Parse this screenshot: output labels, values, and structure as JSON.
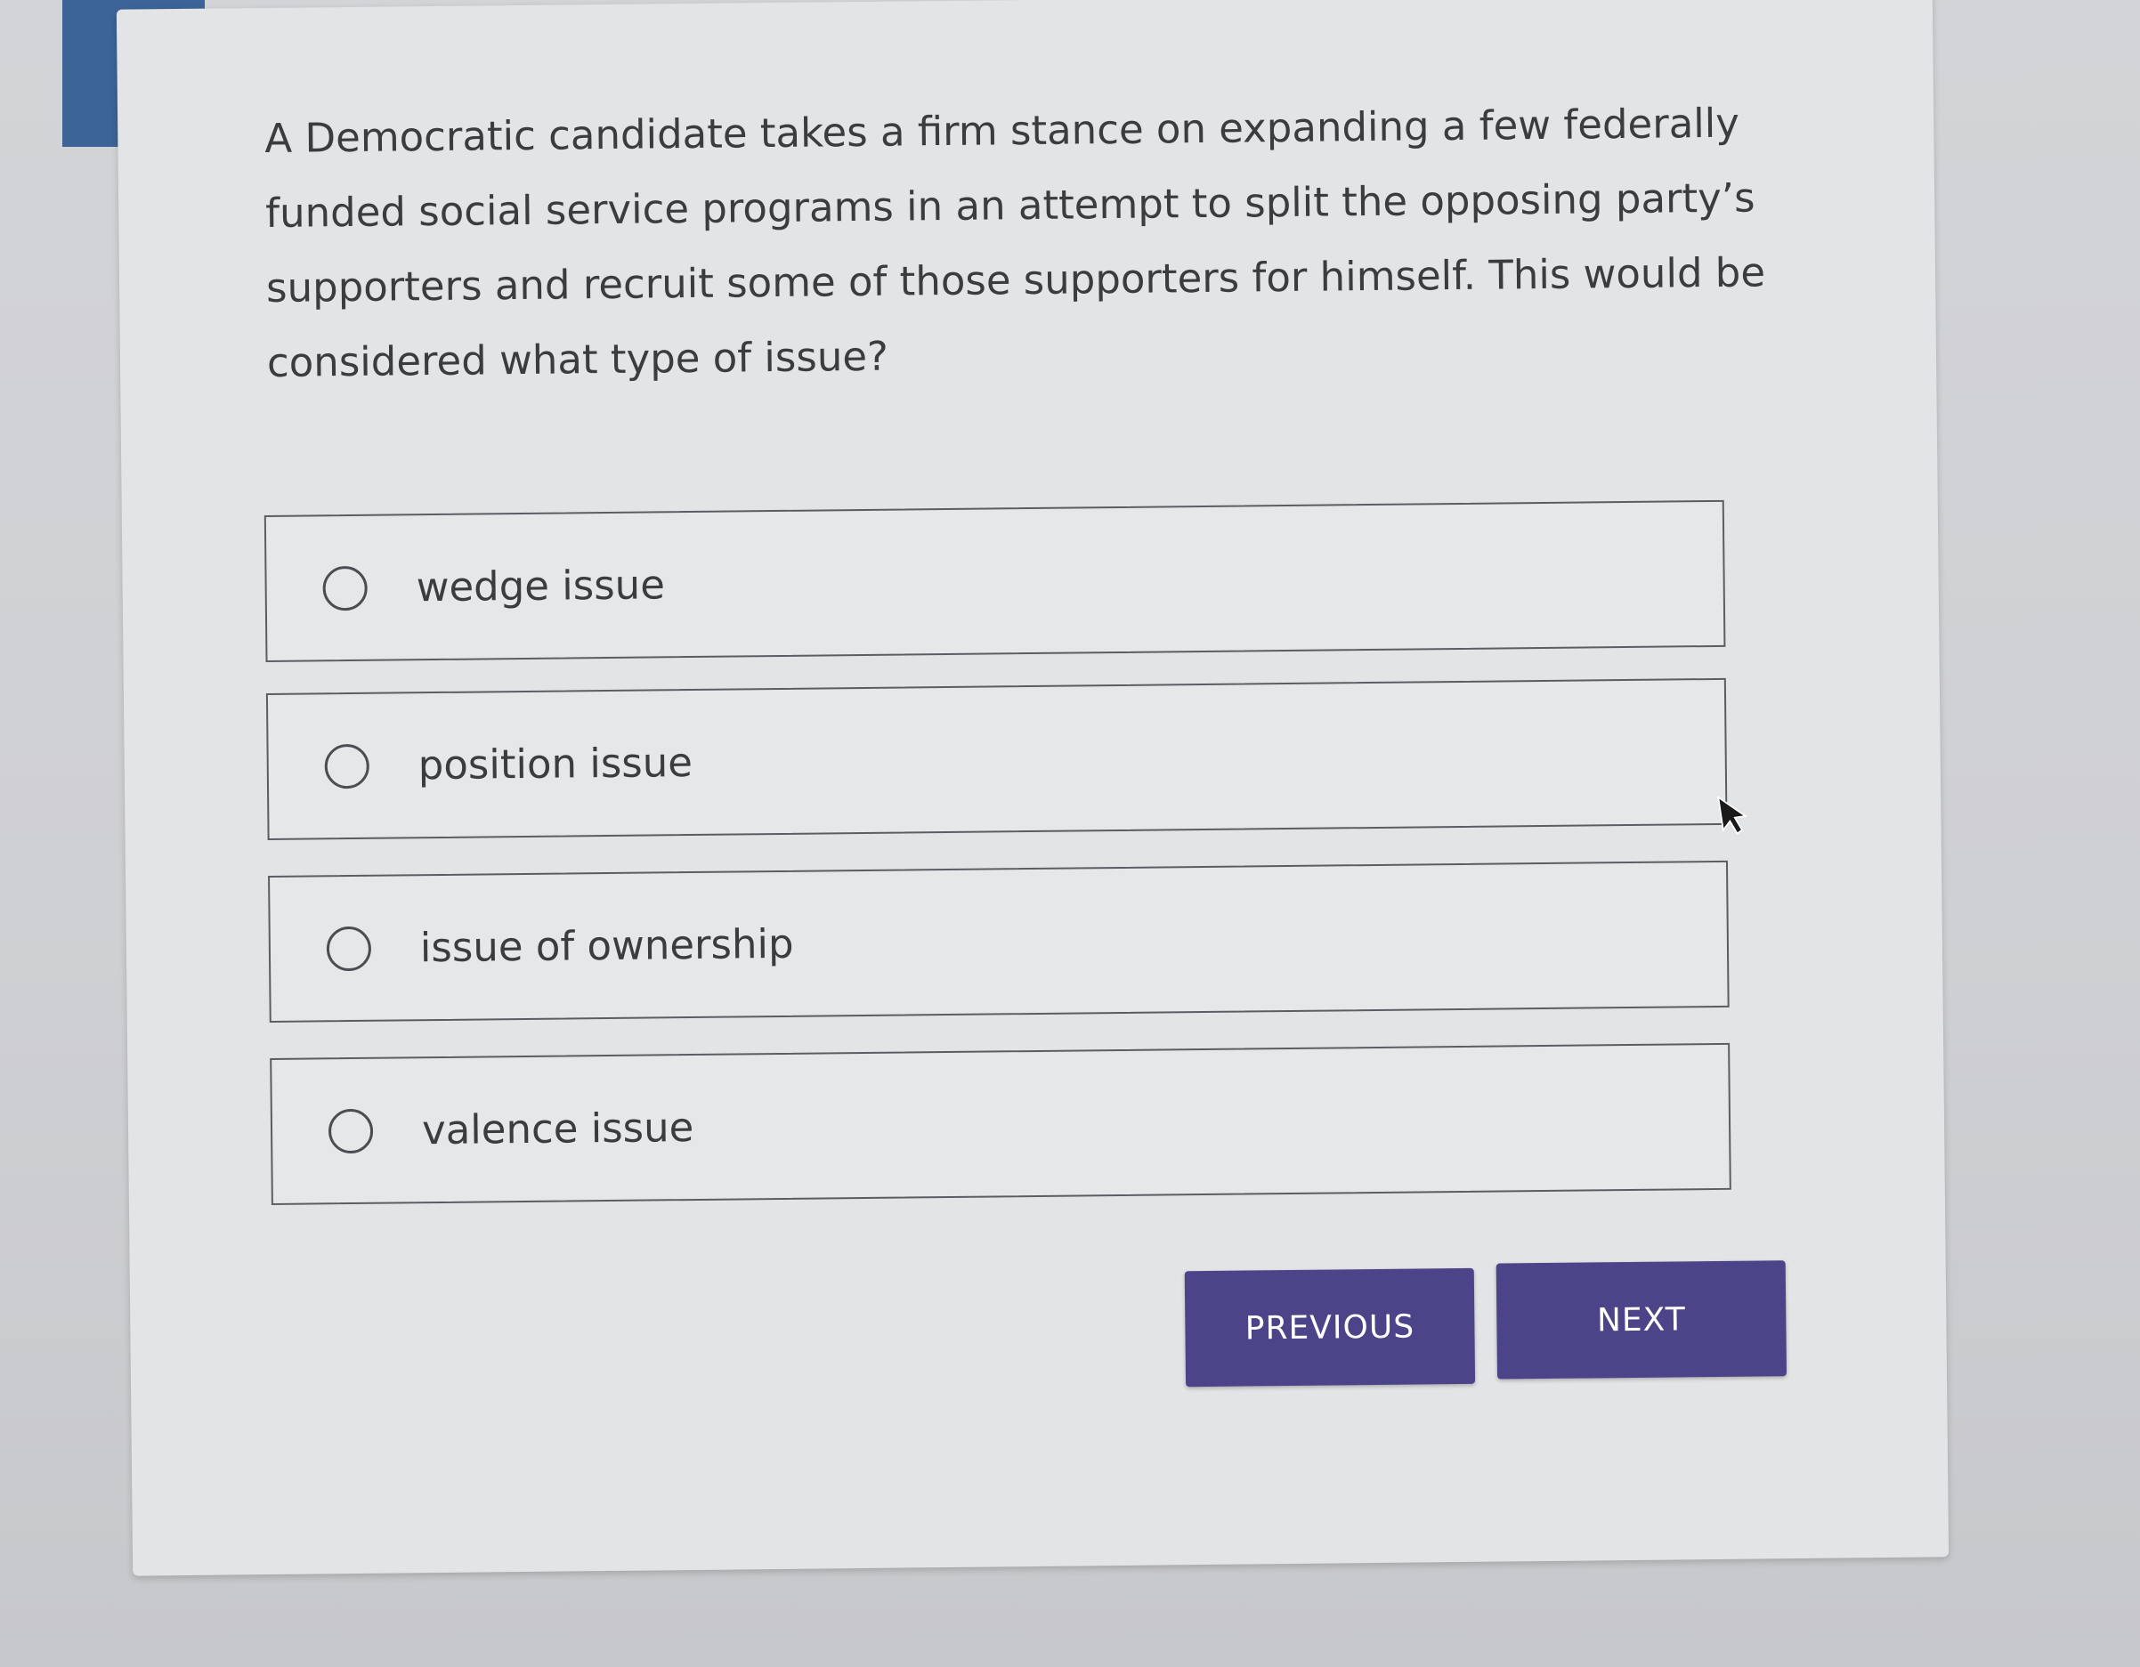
{
  "question": {
    "text": "A Democratic candidate takes a firm stance on expanding a few federally funded social service programs in an attempt to split the opposing party’s supporters and recruit some of those supporters for himself. This would be considered what type of issue?"
  },
  "options": [
    {
      "label": "wedge issue",
      "selected": false
    },
    {
      "label": "position issue",
      "selected": false
    },
    {
      "label": "issue of ownership",
      "selected": false
    },
    {
      "label": "valence issue",
      "selected": false
    }
  ],
  "nav": {
    "previous_label": "PREVIOUS",
    "next_label": "NEXT"
  },
  "colors": {
    "button_bg": "#4b4489",
    "accent_band": "#3d6497",
    "card_bg": "#e3e4e6"
  },
  "icons": {
    "radio": "radio-unchecked-icon",
    "pointer": "mouse-pointer-icon"
  }
}
